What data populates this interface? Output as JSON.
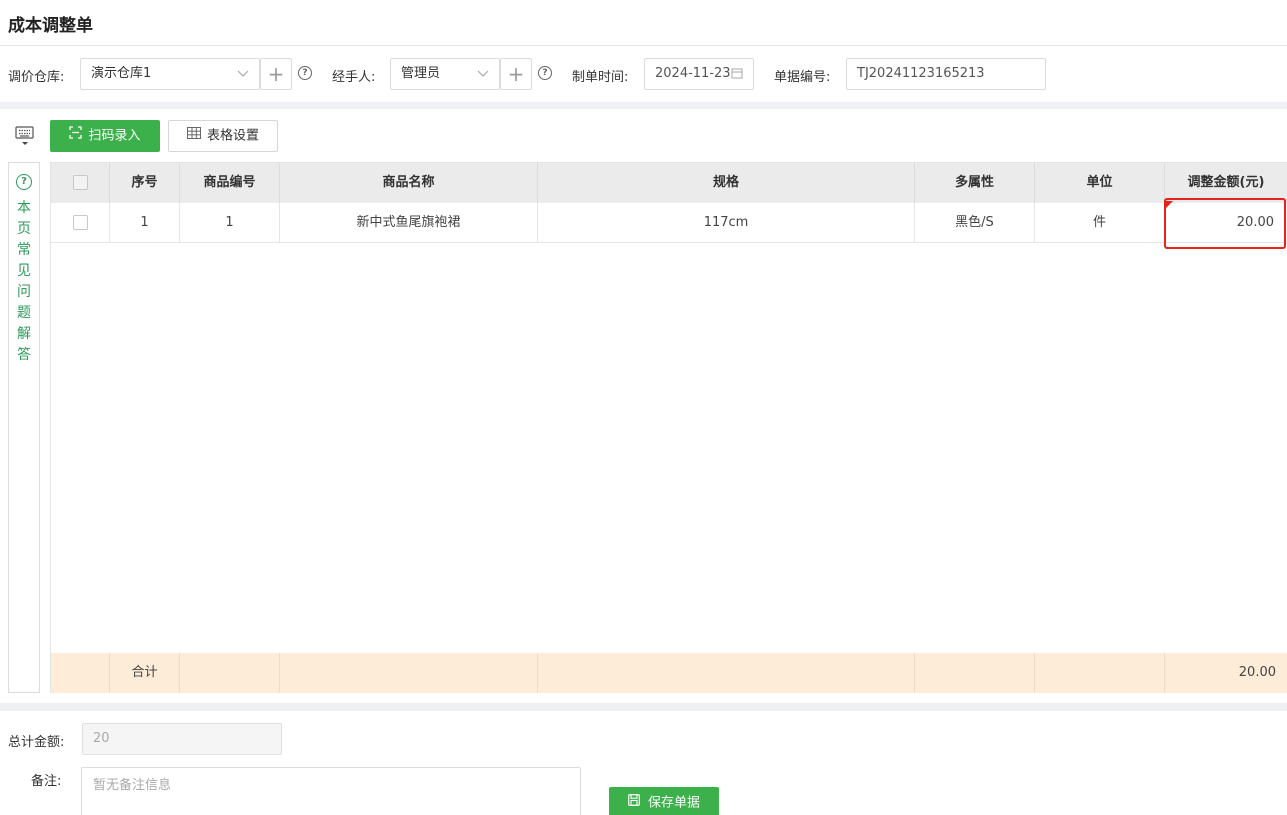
{
  "page_title": "成本调整单",
  "form": {
    "warehouse_label": "调价仓库:",
    "warehouse_value": "演示仓库1",
    "handler_label": "经手人:",
    "handler_value": "管理员",
    "date_label": "制单时间:",
    "date_value": "2024-11-23",
    "doc_no_label": "单据编号:",
    "doc_no_value": "TJ20241123165213"
  },
  "toolbar": {
    "scan_label": "扫码录入",
    "table_settings_label": "表格设置"
  },
  "faq": {
    "label": "本页常见问题解答"
  },
  "table": {
    "columns": [
      "序号",
      "商品编号",
      "商品名称",
      "规格",
      "多属性",
      "单位",
      "调整金额(元)"
    ],
    "rows": [
      {
        "seq": "1",
        "code": "1",
        "name": "新中式鱼尾旗袍裙",
        "spec": "117cm",
        "attr": "黑色/S",
        "unit": "件",
        "amount": "20.00"
      }
    ],
    "footer_label": "合计",
    "footer_amount": "20.00"
  },
  "footer": {
    "total_label": "总计金额:",
    "total_value": "20",
    "memo_label": "备注:",
    "memo_placeholder": "暂无备注信息",
    "save_label": "保存单据"
  },
  "colors": {
    "accent_green": "#3bb04b",
    "highlight_red": "#e8211a",
    "footer_row_bg": "#fcecd8"
  }
}
